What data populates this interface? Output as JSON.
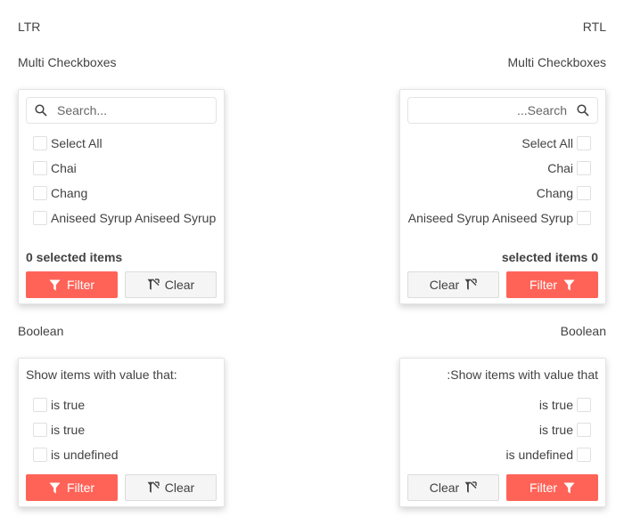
{
  "ltr_heading": "LTR",
  "rtl_heading": "RTL",
  "multi_label": "Multi Checkboxes",
  "boolean_label": "Boolean",
  "search": {
    "placeholder_ltr": "Search...",
    "placeholder_rtl": "Search..."
  },
  "multi_items": [
    "Select All",
    "Chai",
    "Chang",
    "Aniseed Syrup Aniseed Syrup"
  ],
  "selected_count": "0 selected items",
  "selected_count_rtl": "selected items 0",
  "filter_label": "Filter",
  "clear_label": "Clear",
  "bool_prompt": "Show items with value that:",
  "bool_items": [
    "is true",
    "is true",
    "is undefined"
  ],
  "colors": {
    "primary": "#ff6358",
    "secondary": "#f5f5f5",
    "text": "#424242"
  },
  "icons": {
    "search": "search-icon",
    "filter": "filter-icon",
    "clear": "filter-clear-icon"
  }
}
